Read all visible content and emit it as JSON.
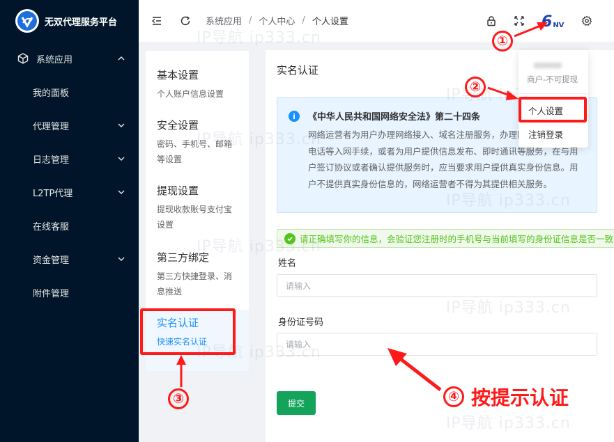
{
  "sidebar": {
    "brand_title": "无双代理服务平台",
    "items": [
      {
        "label": "系统应用",
        "icon": "cube-icon",
        "expanded": true,
        "level": "top"
      },
      {
        "label": "我的面板",
        "level": "sub"
      },
      {
        "label": "代理管理",
        "level": "sub",
        "has_children": true
      },
      {
        "label": "日志管理",
        "level": "sub",
        "has_children": true
      },
      {
        "label": "L2TP代理",
        "level": "sub",
        "has_children": true
      },
      {
        "label": "在线客服",
        "level": "sub"
      },
      {
        "label": "资金管理",
        "level": "sub",
        "has_children": true
      },
      {
        "label": "附件管理",
        "level": "sub"
      }
    ]
  },
  "header": {
    "breadcrumb": [
      "系统应用",
      "个人中心",
      "个人设置"
    ],
    "separator": "/",
    "avatar_text": "6",
    "avatar_suffix": "NV"
  },
  "watermark": "IP导航 ip333.cn",
  "settings_nav": [
    {
      "title": "基本设置",
      "desc": "个人账户信息设置"
    },
    {
      "title": "安全设置",
      "desc": "密码、手机号、邮箱等设置"
    },
    {
      "title": "提现设置",
      "desc": "提现收款账号支付宝设置"
    },
    {
      "title": "第三方绑定",
      "desc": "第三方快捷登录、消息推送"
    },
    {
      "title": "实名认证",
      "desc": "快速实名认证",
      "active": true
    }
  ],
  "main": {
    "title": "实名认证",
    "notice_title": "《中华人民共和国网络安全法》第二十四条",
    "notice_body": "网络运营者为用户办理网络接入、域名注册服务，办理固定电话、移动电话等入网手续，或者为用户提供信息发布、即时通讯等服务，在与用户签订协议或者确认提供服务时，应当要求用户提供真实身份信息。用户不提供真实身份信息的，网络运营者不得为其提供相关服务。",
    "success_text": "请正确填写你的信息，会验证您注册时的手机号与当前填写的身份证信息是否一致",
    "name_label": "姓名",
    "name_placeholder": "请输入",
    "id_label": "身份证号码",
    "id_placeholder": "请输入",
    "submit_label": "提交"
  },
  "dropdown": {
    "user_sub": "商户-不可提现",
    "items": [
      "个人设置",
      "注销登录"
    ]
  },
  "annotations": {
    "n1": "①",
    "n2": "②",
    "n3": "③",
    "n4": "④",
    "step4_text": "按提示认证",
    "color": "#ff1a1a"
  }
}
